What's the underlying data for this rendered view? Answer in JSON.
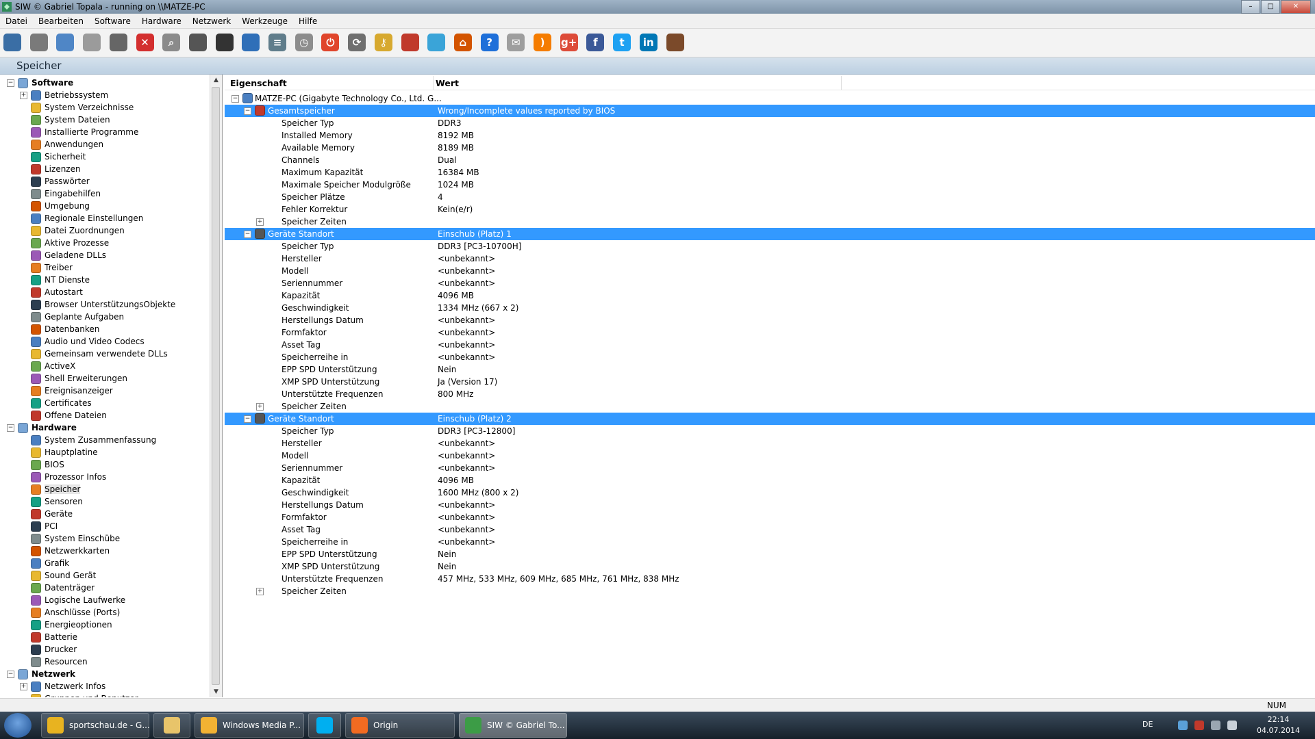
{
  "window": {
    "title": "SIW  © Gabriel Topala - running on \\\\MATZE-PC"
  },
  "menu": [
    "Datei",
    "Bearbeiten",
    "Software",
    "Hardware",
    "Netzwerk",
    "Werkzeuge",
    "Hilfe"
  ],
  "toolbar_icons": [
    "save-icon",
    "cut-icon",
    "copy-icon",
    "paste-icon",
    "print-icon",
    "stop-icon",
    "search-icon",
    "compass-icon",
    "monitor-icon",
    "network-icon",
    "list-icon",
    "timer-icon",
    "shutdown-icon",
    "refresh-icon",
    "key-icon",
    "tools-icon",
    "web-icon",
    "home-icon",
    "help-icon",
    "mail-icon",
    "rss-icon",
    "google-plus-icon",
    "facebook-icon",
    "twitter-icon",
    "linkedin-icon",
    "coffee-icon"
  ],
  "section_title": "Speicher",
  "tree": {
    "software_label": "Software",
    "software_items": [
      "Betriebssystem",
      "System Verzeichnisse",
      "System Dateien",
      "Installierte Programme",
      "Anwendungen",
      "Sicherheit",
      "Lizenzen",
      "Passwörter",
      "Eingabehilfen",
      "Umgebung",
      "Regionale Einstellungen",
      "Datei Zuordnungen",
      "Aktive Prozesse",
      "Geladene DLLs",
      "Treiber",
      "NT Dienste",
      "Autostart",
      "Browser UnterstützungsObjekte",
      "Geplante Aufgaben",
      "Datenbanken",
      "Audio und Video Codecs",
      "Gemeinsam verwendete DLLs",
      "ActiveX",
      "Shell Erweiterungen",
      "Ereignisanzeiger",
      "Certificates",
      "Offene Dateien"
    ],
    "hardware_label": "Hardware",
    "hardware_items": [
      "System Zusammenfassung",
      "Hauptplatine",
      "BIOS",
      "Prozessor Infos",
      "Speicher",
      "Sensoren",
      "Geräte",
      "PCI",
      "System Einschübe",
      "Netzwerkkarten",
      "Grafik",
      "Sound Gerät",
      "Datenträger",
      "Logische Laufwerke",
      "Anschlüsse (Ports)",
      "Energieoptionen",
      "Batterie",
      "Drucker",
      "Resourcen"
    ],
    "network_label": "Netzwerk",
    "network_items": [
      "Netzwerk Infos",
      "Gruppen und Benutzer"
    ],
    "selected": "Speicher"
  },
  "columns": {
    "property": "Eigenschaft",
    "value": "Wert"
  },
  "rows": [
    {
      "n": "MATZE-PC (Gigabyte Technology Co., Ltd. G...",
      "v": ""
    },
    {
      "n": "Gesamtspeicher",
      "v": "Wrong/Incomplete values reported by BIOS"
    },
    {
      "n": "Speicher Typ",
      "v": "DDR3"
    },
    {
      "n": "Installed Memory",
      "v": "8192 MB"
    },
    {
      "n": "Available Memory",
      "v": "8189 MB"
    },
    {
      "n": "Channels",
      "v": "Dual"
    },
    {
      "n": "Maximum Kapazität",
      "v": "16384 MB"
    },
    {
      "n": "Maximale Speicher Modulgröße",
      "v": "1024 MB"
    },
    {
      "n": "Speicher Plätze",
      "v": "4"
    },
    {
      "n": "Fehler Korrektur",
      "v": "Kein(e/r)"
    },
    {
      "n": "Speicher Zeiten",
      "v": ""
    },
    {
      "n": "Geräte Standort",
      "v": "Einschub (Platz) 1"
    },
    {
      "n": "Speicher Typ",
      "v": "DDR3 [PC3-10700H]"
    },
    {
      "n": "Hersteller",
      "v": "<unbekannt>"
    },
    {
      "n": "Modell",
      "v": "<unbekannt>"
    },
    {
      "n": "Seriennummer",
      "v": "<unbekannt>"
    },
    {
      "n": "Kapazität",
      "v": "4096 MB"
    },
    {
      "n": "Geschwindigkeit",
      "v": "1334 MHz (667 x 2)"
    },
    {
      "n": "Herstellungs Datum",
      "v": "<unbekannt>"
    },
    {
      "n": "Formfaktor",
      "v": "<unbekannt>"
    },
    {
      "n": "Asset Tag",
      "v": "<unbekannt>"
    },
    {
      "n": "Speicherreihe in",
      "v": "<unbekannt>"
    },
    {
      "n": "EPP SPD Unterstützung",
      "v": "Nein"
    },
    {
      "n": "XMP SPD Unterstützung",
      "v": "Ja (Version 17)"
    },
    {
      "n": "Unterstützte Frequenzen",
      "v": "800 MHz"
    },
    {
      "n": "Speicher Zeiten",
      "v": ""
    },
    {
      "n": "Geräte Standort",
      "v": "Einschub (Platz) 2"
    },
    {
      "n": "Speicher Typ",
      "v": "DDR3 [PC3-12800]"
    },
    {
      "n": "Hersteller",
      "v": "<unbekannt>"
    },
    {
      "n": "Modell",
      "v": "<unbekannt>"
    },
    {
      "n": "Seriennummer",
      "v": "<unbekannt>"
    },
    {
      "n": "Kapazität",
      "v": "4096 MB"
    },
    {
      "n": "Geschwindigkeit",
      "v": "1600 MHz (800 x 2)"
    },
    {
      "n": "Herstellungs Datum",
      "v": "<unbekannt>"
    },
    {
      "n": "Formfaktor",
      "v": "<unbekannt>"
    },
    {
      "n": "Asset Tag",
      "v": "<unbekannt>"
    },
    {
      "n": "Speicherreihe in",
      "v": "<unbekannt>"
    },
    {
      "n": "EPP SPD Unterstützung",
      "v": "Nein"
    },
    {
      "n": "XMP SPD Unterstützung",
      "v": "Nein"
    },
    {
      "n": "Unterstützte Frequenzen",
      "v": "457 MHz, 533 MHz, 609 MHz, 685 MHz, 761 MHz, 838 MHz"
    },
    {
      "n": "Speicher Zeiten",
      "v": ""
    }
  ],
  "status": {
    "num": "NUM"
  },
  "taskbar": {
    "items": [
      {
        "label": "sportschau.de - G...",
        "icon": "chrome-icon"
      },
      {
        "label": "",
        "icon": "explorer-icon"
      },
      {
        "label": "Windows Media P...",
        "icon": "media-player-icon"
      },
      {
        "label": "",
        "icon": "skype-icon"
      },
      {
        "label": "Origin",
        "icon": "origin-icon"
      },
      {
        "label": "SIW  © Gabriel To...",
        "icon": "siw-icon"
      }
    ],
    "lang": "DE",
    "time": "22:14",
    "date": "04.07.2014"
  }
}
